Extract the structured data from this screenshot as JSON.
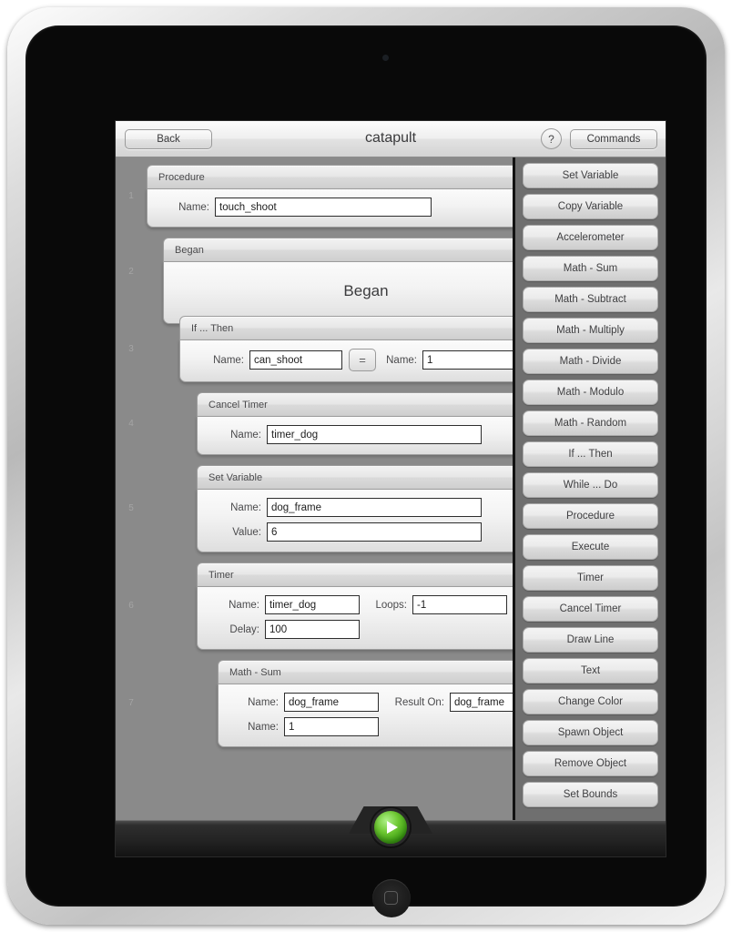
{
  "toolbar": {
    "back_label": "Back",
    "title": "catapult",
    "help_label": "?",
    "commands_label": "Commands"
  },
  "script": {
    "blocks": [
      {
        "step": "1",
        "title": "Procedure",
        "indent": 0,
        "has_trash": true,
        "rows": [
          {
            "label": "Name:",
            "value": "touch_shoot",
            "field_width": 238
          }
        ]
      },
      {
        "step": "2",
        "title": "Began",
        "indent": 1,
        "has_trash": false,
        "big_label": "Began",
        "rows": []
      },
      {
        "step": "3",
        "title": "If ... Then",
        "indent": 2,
        "has_trash": true,
        "rows": [
          {
            "label": "Name:",
            "value": "can_shoot",
            "field_width": 102
          },
          {
            "label": "Name:",
            "value": "1",
            "field_width": 102
          }
        ],
        "operator": "="
      },
      {
        "step": "4",
        "title": "Cancel Timer",
        "indent": 3,
        "has_trash": false,
        "rows": [
          {
            "label": "Name:",
            "value": "timer_dog",
            "field_width": 236
          }
        ]
      },
      {
        "step": "5",
        "title": "Set Variable",
        "indent": 3,
        "has_trash": false,
        "rows": [
          {
            "label": "Name:",
            "value": "dog_frame",
            "field_width": 236
          },
          {
            "label": "Value:",
            "value": "6",
            "field_width": 236
          }
        ]
      },
      {
        "step": "6",
        "title": "Timer",
        "indent": 3,
        "has_trash": false,
        "rows": [
          {
            "label": "Name:",
            "value": "timer_dog",
            "field_width": 104
          },
          {
            "label": "Loops:",
            "value": "-1",
            "field_width": 104
          },
          {
            "label": "Delay:",
            "value": "100",
            "field_width": 104
          }
        ]
      },
      {
        "step": "7",
        "title": "Math - Sum",
        "indent": 4,
        "has_trash": false,
        "rows": [
          {
            "label": "Name:",
            "value": "dog_frame",
            "field_width": 104
          },
          {
            "label": "Result On:",
            "value": "dog_frame",
            "field_width": 104
          },
          {
            "label": "Name:",
            "value": "1",
            "field_width": 104
          }
        ]
      }
    ]
  },
  "palette": {
    "items": [
      {
        "label": "Set Variable"
      },
      {
        "label": "Copy Variable"
      },
      {
        "label": "Accelerometer"
      },
      {
        "label": "Math - Sum"
      },
      {
        "label": "Math - Subtract"
      },
      {
        "label": "Math - Multiply"
      },
      {
        "label": "Math - Divide"
      },
      {
        "label": "Math - Modulo"
      },
      {
        "label": "Math - Random"
      },
      {
        "label": "If ... Then"
      },
      {
        "label": "While ... Do"
      },
      {
        "label": "Procedure"
      },
      {
        "label": "Execute"
      },
      {
        "label": "Timer"
      },
      {
        "label": "Cancel Timer"
      },
      {
        "label": "Draw Line"
      },
      {
        "label": "Text"
      },
      {
        "label": "Change Color"
      },
      {
        "label": "Spawn Object"
      },
      {
        "label": "Remove Object"
      },
      {
        "label": "Set Bounds"
      }
    ]
  },
  "bottom": {
    "play_label": "play-button"
  },
  "colors": {
    "canvas_bg": "#8a8a8a",
    "palette_bg": "#6f6f6f",
    "accent_green": "#5fbf28",
    "toolbar_bg": "#e8e8e8"
  }
}
